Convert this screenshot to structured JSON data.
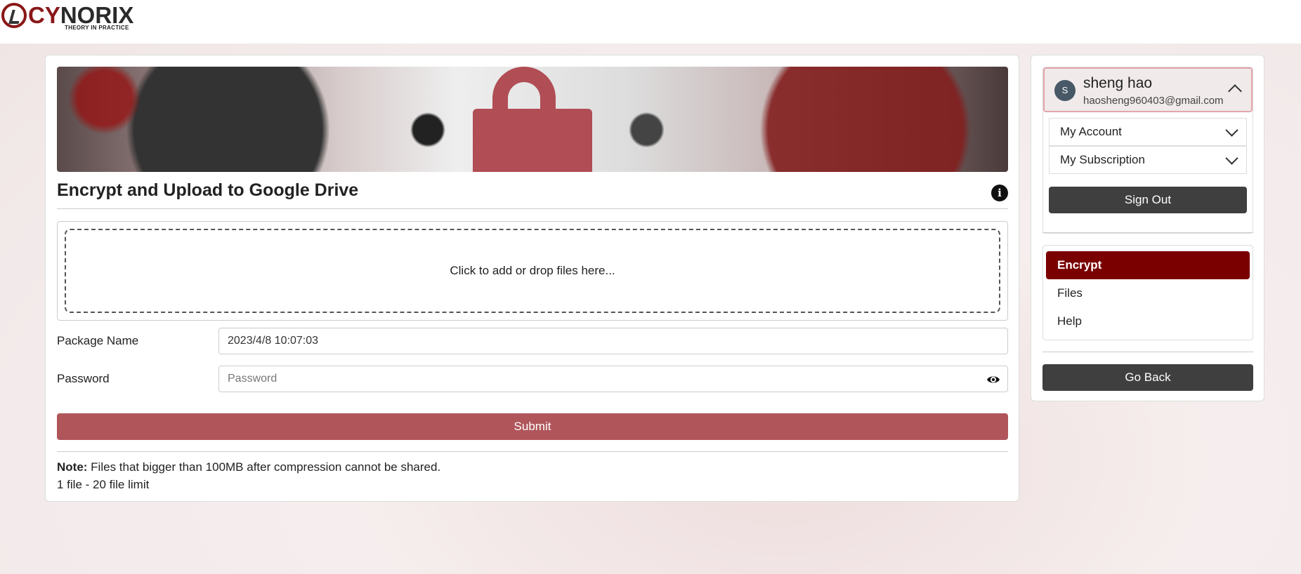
{
  "brand": {
    "name_part1": "CY",
    "name_part2": "NORIX",
    "tagline": "THEORY IN PRACTICE"
  },
  "main": {
    "title": "Encrypt and Upload to Google Drive",
    "info_icon": "info-icon",
    "dropzone_text": "Click to add or drop files here...",
    "package_label": "Package Name",
    "package_value": "2023/4/8 10:07:03",
    "password_label": "Password",
    "password_placeholder": "Password",
    "submit_label": "Submit",
    "note_bold": "Note:",
    "note_text": " Files that bigger than 100MB after compression cannot be shared.",
    "limit_text": "1 file - 20 file limit"
  },
  "sidebar": {
    "user": {
      "initial": "S",
      "name": "sheng hao",
      "email": "haosheng960403@gmail.com"
    },
    "account_items": [
      {
        "label": "My Account"
      },
      {
        "label": "My Subscription"
      }
    ],
    "sign_out_label": "Sign Out",
    "nav": [
      {
        "label": "Encrypt",
        "active": true
      },
      {
        "label": "Files"
      },
      {
        "label": "Help"
      }
    ],
    "go_back_label": "Go Back"
  },
  "colors": {
    "accent": "#7a0000",
    "submit": "#b0565b",
    "dark_button": "#3f3f3f"
  }
}
